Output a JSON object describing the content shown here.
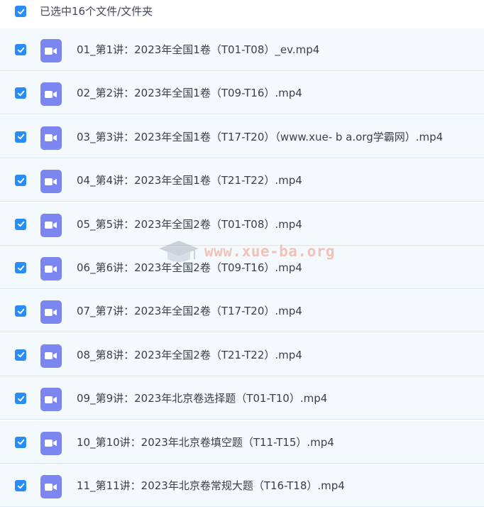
{
  "header": {
    "select_all_label": "已选中16个文件/文件夹"
  },
  "colors": {
    "checkbox": "#2a8cf7",
    "video_icon": "#7b86f0",
    "row_background": "#f4f9fe"
  },
  "icons": {
    "checkbox": "checkmark-icon",
    "file": "video-file-icon"
  },
  "files": [
    {
      "name": "01_第1讲：2023年全国1卷（T01-T08）_ev.mp4"
    },
    {
      "name": "02_第2讲：2023年全国1卷（T09-T16）.mp4"
    },
    {
      "name": "03_第3讲：2023年全国1卷（T17-T20）（www.xue- b a.org学霸网）.mp4"
    },
    {
      "name": "04_第4讲：2023年全国1卷（T21-T22）.mp4"
    },
    {
      "name": "05_第5讲：2023年全国2卷（T01-T08）.mp4"
    },
    {
      "name": "06_第6讲：2023年全国2卷（T09-T16）.mp4"
    },
    {
      "name": "07_第7讲：2023年全国2卷（T17-T20）.mp4"
    },
    {
      "name": "08_第8讲：2023年全国2卷（T21-T22）.mp4"
    },
    {
      "name": "09_第9讲：2023年北京卷选择题（T01-T10）.mp4"
    },
    {
      "name": "10_第10讲：2023年北京卷填空题（T11-T15）.mp4"
    },
    {
      "name": "11_第11讲：2023年北京卷常规大题（T16-T18）.mp4"
    }
  ],
  "watermark": {
    "text": "www.xue-ba.org"
  }
}
